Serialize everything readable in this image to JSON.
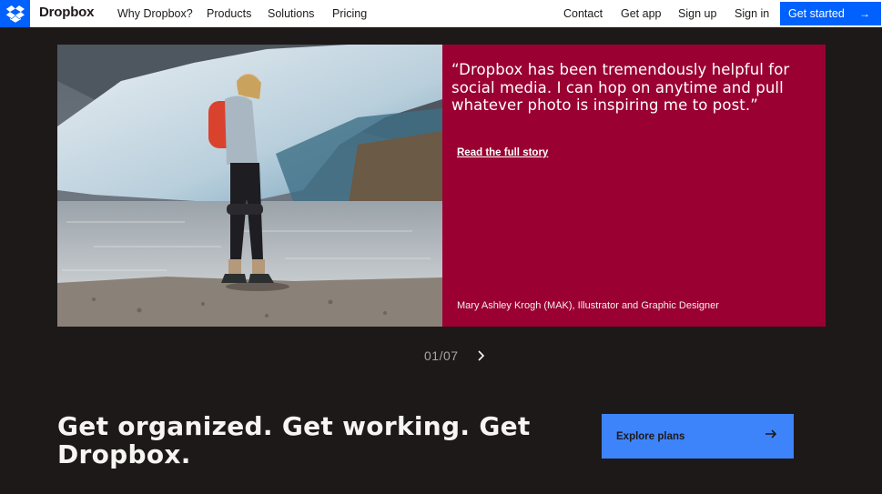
{
  "nav": {
    "brand": "Dropbox",
    "links": [
      "Why Dropbox?",
      "Products",
      "Solutions",
      "Pricing"
    ],
    "right_links": [
      "Contact",
      "Get app",
      "Sign up",
      "Sign in"
    ],
    "cta": "Get started",
    "cta_icon": "arrow-right-icon",
    "logo_icon": "dropbox-logo-icon"
  },
  "testimonial": {
    "quote": "“Dropbox has been tremendously helpful for social media. I can hop on anytime and pull whatever photo is inspiring me to post.”",
    "link": "Read the full story",
    "attribution": "Mary Ashley Krogh (MAK), Illustrator and Graphic Designer",
    "photo_subject": "woman-hiker-with-camera-at-glacier"
  },
  "pager": {
    "label": "01/07",
    "next_icon": "chevron-right-icon"
  },
  "cta_section": {
    "headline": "Get organized. Get working. Get Dropbox.",
    "button": "Explore plans",
    "button_icon": "arrow-right-icon"
  },
  "colors": {
    "brand_blue": "#0061fe",
    "page_bg": "#1e1919",
    "quote_panel": "#9b0032",
    "explore_button": "#3d84fb"
  }
}
